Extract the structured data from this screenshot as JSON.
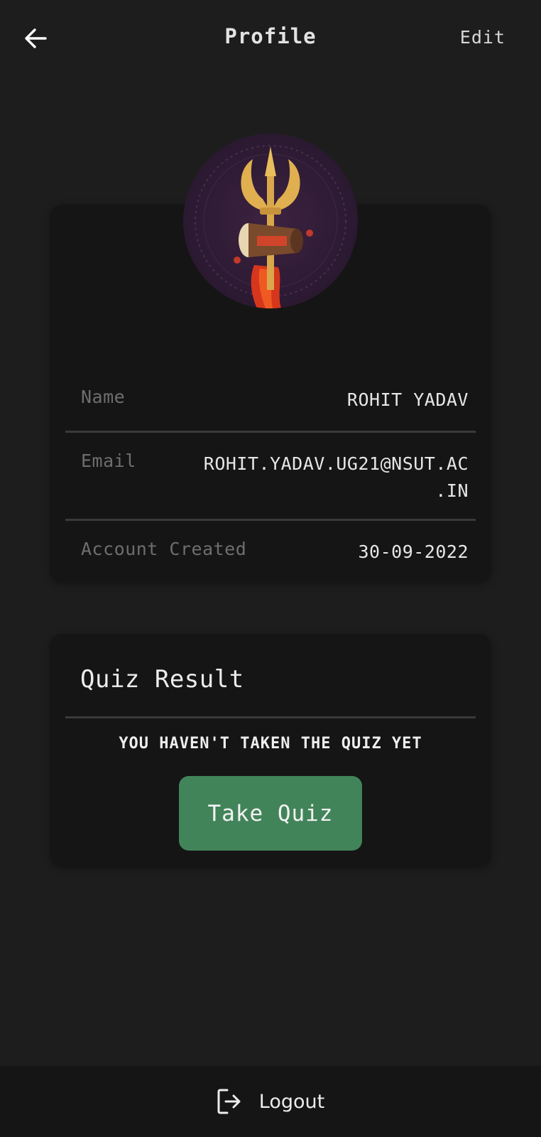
{
  "header": {
    "back_icon": "arrow-left-icon",
    "title": "Profile",
    "edit_label": "Edit"
  },
  "profile": {
    "avatar_icon": "trishul-damru-icon",
    "fields": [
      {
        "label": "Name",
        "value": "ROHIT YADAV"
      },
      {
        "label": "Email",
        "value_line1": "ROHIT.YADAV.UG21@NSUT.AC",
        "value_line2": ".IN"
      },
      {
        "label": "Account Created",
        "value": "30-09-2022"
      }
    ]
  },
  "quiz": {
    "title": "Quiz Result",
    "message": "YOU HAVEN'T TAKEN THE QUIZ YET",
    "button_label": "Take Quiz"
  },
  "footer": {
    "logout_icon": "logout-icon",
    "logout_label": "Logout"
  },
  "colors": {
    "background": "#1d1d1d",
    "card": "#151515",
    "accent_button": "#42845a",
    "label_text": "#6e6e6e"
  }
}
